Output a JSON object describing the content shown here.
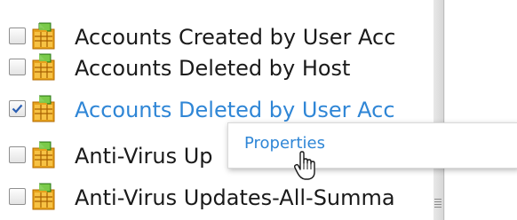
{
  "rows": [
    {
      "label": "Accounts Created by User Acc",
      "checked": false,
      "hovered": false
    },
    {
      "label": "Accounts Deleted by Host",
      "checked": false,
      "hovered": false
    },
    {
      "label": "Accounts Deleted by User Acc",
      "checked": true,
      "hovered": true
    },
    {
      "label": "Anti-Virus Up",
      "checked": false,
      "hovered": false
    },
    {
      "label": "Anti-Virus Updates-All-Summa",
      "checked": false,
      "hovered": false
    }
  ],
  "context_menu": {
    "items": [
      "Properties"
    ]
  },
  "colors": {
    "link": "#2f86d6",
    "text": "#1a1a1a"
  },
  "icons": {
    "row_icon": "report-table-icon",
    "cursor": "hand-pointer-icon"
  }
}
